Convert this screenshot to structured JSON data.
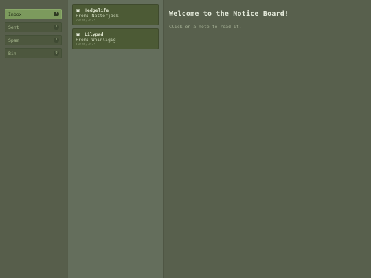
{
  "sidebar": {
    "folders": [
      {
        "label": "Inbox",
        "count": "2"
      },
      {
        "label": "Sent",
        "count": "1"
      },
      {
        "label": "Spam",
        "count": "1"
      },
      {
        "label": "Bin",
        "count": "0"
      }
    ]
  },
  "notes": [
    {
      "title": "Hedgelife",
      "from": "From: Natterjack",
      "date": "29/06/2023"
    },
    {
      "title": "Lilypad",
      "from": "From: Whirligig",
      "date": "19/06/2023"
    }
  ],
  "reader": {
    "heading": "Welcome to the Notice Board!",
    "hint": "Click on a note to read it."
  }
}
